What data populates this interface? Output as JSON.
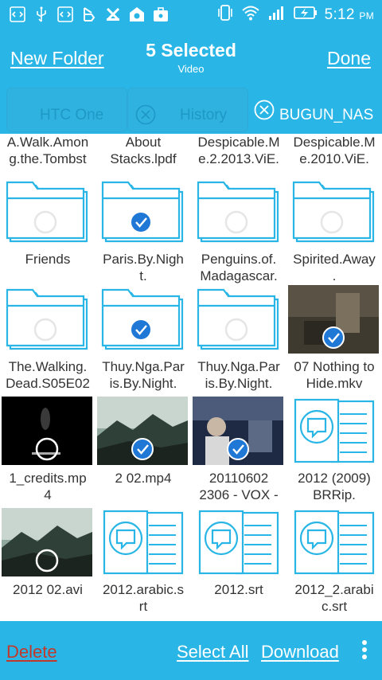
{
  "status_bar": {
    "time": "5:12",
    "ampm": "PM",
    "left_icons": [
      "code-icon",
      "usb-icon",
      "code-icon",
      "bluetooth-app-icon",
      "x-app-icon",
      "home-shield-icon",
      "briefcase-icon"
    ],
    "right_icons": [
      "vibrate-icon",
      "wifi-icon",
      "signal-icon",
      "battery-charging-icon"
    ]
  },
  "header": {
    "new_folder": "New Folder",
    "title": "5 Selected",
    "subtitle": "Video",
    "done": "Done"
  },
  "tabs": [
    {
      "label": "HTC One",
      "active": false
    },
    {
      "label": "History",
      "active": false
    },
    {
      "label": "BUGUN_NAS",
      "active": true
    }
  ],
  "items": [
    {
      "type": "partial",
      "name": "A.Walk.Amon\ng.the.Tombst"
    },
    {
      "type": "partial",
      "name": "About\nStacks.lpdf"
    },
    {
      "type": "partial",
      "name": "Despicable.M\ne.2.2013.ViE."
    },
    {
      "type": "partial",
      "name": "Despicable.M\ne.2010.ViE."
    },
    {
      "type": "folder",
      "selected": false,
      "name": "Friends"
    },
    {
      "type": "folder",
      "selected": true,
      "name": "Paris.By.Nigh\nt."
    },
    {
      "type": "folder",
      "selected": false,
      "name": "Penguins.of.\nMadagascar."
    },
    {
      "type": "folder",
      "selected": false,
      "name": "Spirited.Away\n."
    },
    {
      "type": "folder",
      "selected": false,
      "name": "The.Walking.\nDead.S05E02"
    },
    {
      "type": "folder",
      "selected": true,
      "name": "Thuy.Nga.Par\nis.By.Night."
    },
    {
      "type": "folder",
      "selected": false,
      "name": "Thuy.Nga.Par\nis.By.Night."
    },
    {
      "type": "video",
      "selected": true,
      "scene": "dim-room",
      "name": "07 Nothing to\nHide.mkv"
    },
    {
      "type": "video",
      "selected": false,
      "scene": "dark-credits",
      "name": "1_credits.mp\n4"
    },
    {
      "type": "video",
      "selected": true,
      "scene": "mountain",
      "name": "2 02.mp4"
    },
    {
      "type": "video",
      "selected": true,
      "scene": "studio",
      "name": "20110602\n2306 - VOX -"
    },
    {
      "type": "subtitle",
      "selected": false,
      "name": "2012 (2009)\nBRRip."
    },
    {
      "type": "video",
      "selected": false,
      "scene": "mountain",
      "name": "2012 02.avi"
    },
    {
      "type": "subtitle",
      "selected": false,
      "name": "2012.arabic.s\nrt"
    },
    {
      "type": "subtitle",
      "selected": false,
      "name": "2012.srt"
    },
    {
      "type": "subtitle",
      "selected": false,
      "name": "2012_2.arabi\nc.srt"
    }
  ],
  "bottom_bar": {
    "delete": "Delete",
    "select_all": "Select All",
    "download": "Download"
  },
  "colors": {
    "bar": "#29b6e6",
    "folder_stroke": "#29b6e6",
    "check_fill": "#1f78d6",
    "delete_text": "#c0392b"
  }
}
